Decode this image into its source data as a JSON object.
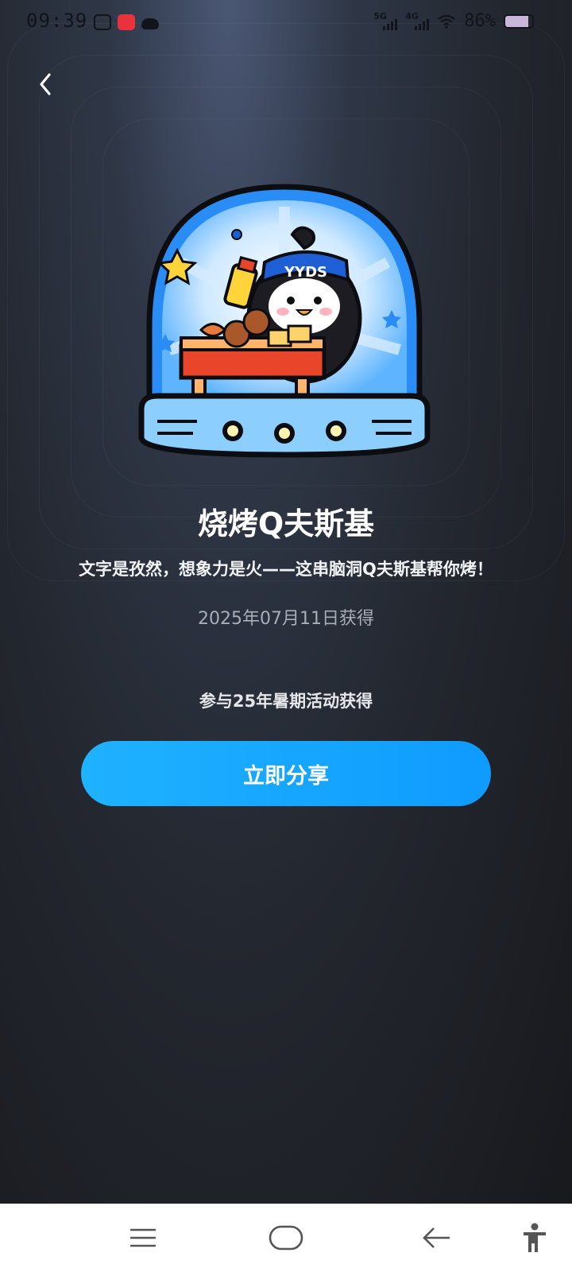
{
  "status_bar": {
    "time": "09:39",
    "network_1": "5G",
    "network_2": "4G",
    "battery": "86%"
  },
  "badge": {
    "title": "烧烤Q夫斯基",
    "description": "文字是孜然，想象力是火——这串脑洞Q夫斯基帮你烤！",
    "obtained_date": "2025年07月11日获得",
    "source": "参与25年暑期活动获得",
    "image_label": "YYDS"
  },
  "actions": {
    "share_label": "立即分享"
  },
  "icons": {
    "back": "chevron-left-icon",
    "menu": "menu-icon",
    "home": "home-icon",
    "nav_back": "arrow-left-icon",
    "accessibility": "accessibility-icon"
  },
  "colors": {
    "share_button": "#1fb2ff",
    "background": "#1b1d22",
    "accent": "#0f9bff"
  }
}
